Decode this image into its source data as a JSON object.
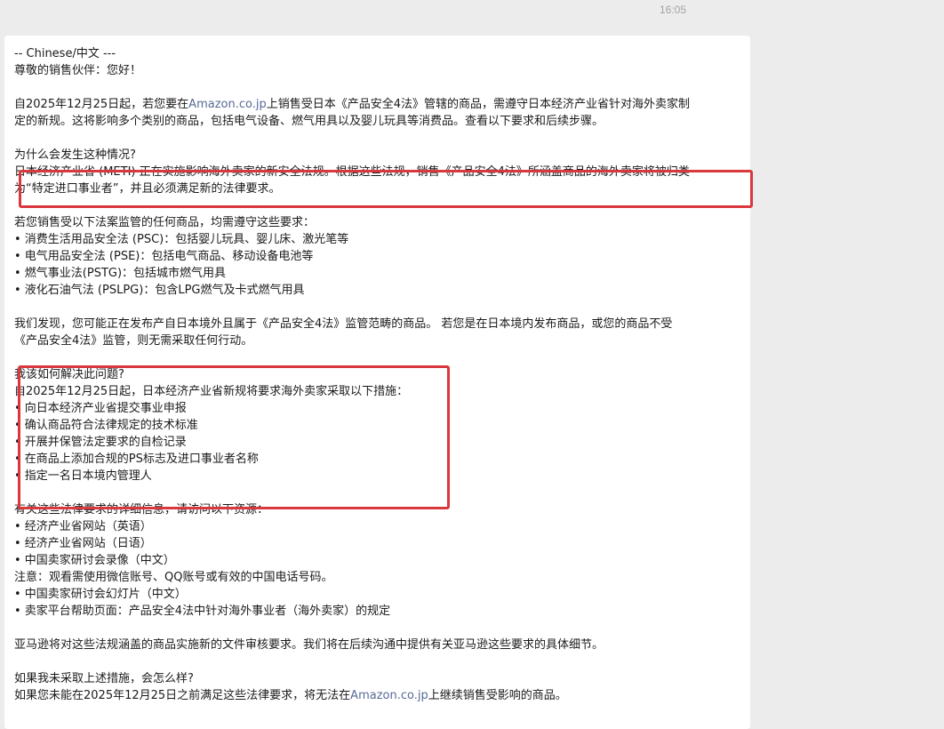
{
  "timestamp": "16:05",
  "message": {
    "lang_header": "-- Chinese/中文 ---",
    "greeting": "尊敬的销售伙伴：您好！",
    "intro": {
      "l1_pre": "自2025年12月25日起，若您要在",
      "l1_link": "Amazon.co.jp",
      "l1_post": "上销售受日本《产品安全4法》管辖的商品，需遵守日本经济产业省针对海外卖家制",
      "l2": "定的新规。这将影响多个类别的商品，包括电气设备、燃气用具以及婴儿玩具等消费品。查看以下要求和后续步骤。"
    },
    "why": {
      "heading": "为什么会发生这种情况?",
      "l1": "日本经济产业省 (METI) 正在实施影响海外卖家的新安全法规。根据这些法规，销售《产品安全4法》所涵盖商品的海外卖家将被归类",
      "l2": "为“特定进口事业者”，并且必须满足新的法律要求。"
    },
    "laws": {
      "intro": "若您销售受以下法案监管的任何商品，均需遵守这些要求：",
      "items": [
        "• 消费生活用品安全法 (PSC)：包括婴儿玩具、婴儿床、激光笔等",
        "• 电气用品安全法 (PSE)：包括电气商品、移动设备电池等",
        "• 燃气事业法(PSTG)：包括城市燃气用具",
        "• 液化石油气法 (PSLPG)：包含LPG燃气及卡式燃气用具"
      ]
    },
    "found": {
      "l1": "我们发现，您可能正在发布产自日本境外且属于《产品安全4法》监管范畴的商品。 若您是在日本境内发布商品，或您的商品不受",
      "l2": "《产品安全4法》监管，则无需采取任何行动。"
    },
    "solve": {
      "heading": "我该如何解决此问题?",
      "intro": "自2025年12月25日起，日本经济产业省新规将要求海外卖家采取以下措施：",
      "items": [
        "• 向日本经济产业省提交事业申报",
        "• 确认商品符合法律规定的技术标准",
        "• 开展并保管法定要求的自检记录",
        "• 在商品上添加合规的PS标志及进口事业者名称",
        "• 指定一名日本境内管理人"
      ]
    },
    "resources": {
      "intro": "有关这些法律要求的详细信息，请访问以下资源：",
      "items": [
        "• 经济产业省网站（英语）",
        "• 经济产业省网站（日语）",
        "• 中国卖家研讨会录像（中文）",
        "注意：观看需使用微信账号、QQ账号或有效的中国电话号码。",
        "• 中国卖家研讨会幻灯片（中文）",
        "• 卖家平台帮助页面：产品安全4法中针对海外事业者（海外卖家）的规定"
      ]
    },
    "review": "亚马逊将对这些法规涵盖的商品实施新的文件审核要求。我们将在后续沟通中提供有关亚马逊这些要求的具体细节。",
    "noaction": {
      "heading": "如果我未采取上述措施，会怎么样?",
      "l1_pre": "如果您未能在2025年12月25日之前满足这些法律要求，将无法在",
      "l1_link": "Amazon.co.jp",
      "l1_post": "上继续销售受影响的商品。"
    }
  }
}
